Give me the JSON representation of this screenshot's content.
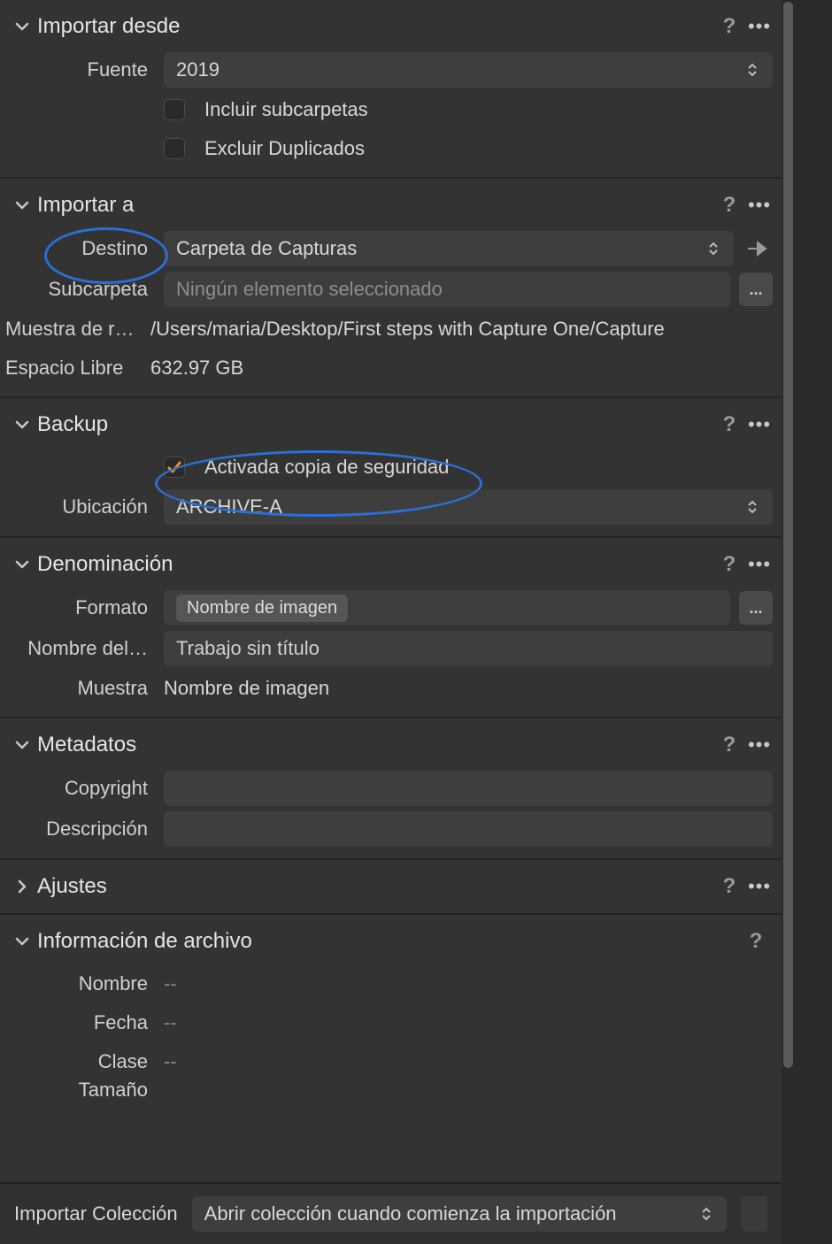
{
  "import_from": {
    "title": "Importar desde",
    "source_label": "Fuente",
    "source_value": "2019",
    "include_subfolders_label": "Incluir subcarpetas",
    "include_subfolders_checked": false,
    "exclude_duplicates_label": "Excluir Duplicados",
    "exclude_duplicates_checked": false
  },
  "import_to": {
    "title": "Importar a",
    "destination_label": "Destino",
    "destination_value": "Carpeta de Capturas",
    "subfolder_label": "Subcarpeta",
    "subfolder_placeholder": "Ningún elemento seleccionado",
    "sample_label": "Muestra de r…",
    "sample_value": "/Users/maria/Desktop/First steps with Capture One/Capture",
    "free_space_label": "Espacio Libre",
    "free_space_value": "632.97 GB"
  },
  "backup": {
    "title": "Backup",
    "enabled_label": "Activada copia de seguridad",
    "enabled_checked": true,
    "location_label": "Ubicación",
    "location_value": "ARCHIVE-A"
  },
  "naming": {
    "title": "Denominación",
    "format_label": "Formato",
    "format_token": "Nombre de imagen",
    "jobname_label": "Nombre del…",
    "jobname_value": "Trabajo sin título",
    "sample_label": "Muestra",
    "sample_value": "Nombre de imagen"
  },
  "metadata": {
    "title": "Metadatos",
    "copyright_label": "Copyright",
    "copyright_value": "",
    "description_label": "Descripción",
    "description_value": ""
  },
  "adjustments": {
    "title": "Ajustes"
  },
  "fileinfo": {
    "title": "Información de archivo",
    "name_label": "Nombre",
    "name_value": "--",
    "date_label": "Fecha",
    "date_value": "--",
    "class_label": "Clase",
    "class_value": "--",
    "size_label": "Tamaño"
  },
  "footer": {
    "collection_label": "Importar Colección",
    "collection_value": "Abrir colección cuando comienza la importación"
  },
  "ellipsis": "...",
  "help_text": "?",
  "more_text": "•••"
}
